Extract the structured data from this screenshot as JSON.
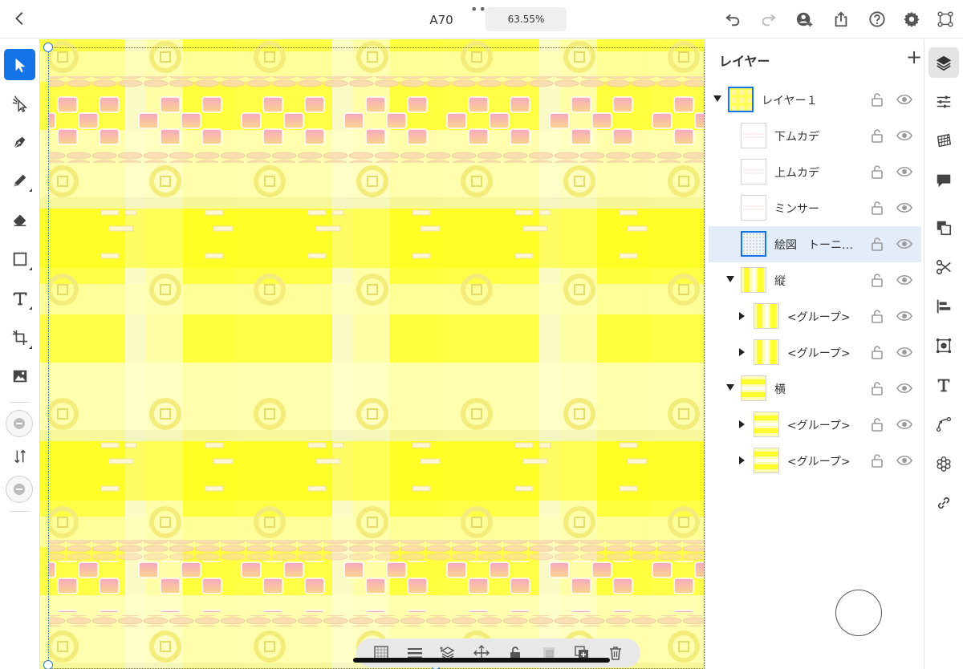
{
  "topbar": {
    "back": "back",
    "title": "A70",
    "more": "•••",
    "zoom": "63.55%"
  },
  "panel": {
    "title": "レイヤー",
    "add": "+",
    "layers": [
      {
        "name": "レイヤー１",
        "depth": 0,
        "expander": "down",
        "thumb": "pattern",
        "selected": false
      },
      {
        "name": "下ムカデ",
        "depth": 1,
        "expander": "none",
        "thumb": "blank",
        "selected": false
      },
      {
        "name": "上ムカデ",
        "depth": 1,
        "expander": "none",
        "thumb": "blank",
        "selected": false
      },
      {
        "name": "ミンサー",
        "depth": 1,
        "expander": "none",
        "thumb": "blank",
        "selected": false
      },
      {
        "name": "絵図　トーニ…",
        "depth": 1,
        "expander": "none",
        "thumb": "dots",
        "selected": true
      },
      {
        "name": "縦",
        "depth": 1,
        "expander": "down",
        "thumb": "vstripes",
        "selected": false
      },
      {
        "name": "<グループ>",
        "depth": 2,
        "expander": "right",
        "thumb": "vstripes",
        "selected": false
      },
      {
        "name": "<グループ>",
        "depth": 2,
        "expander": "right",
        "thumb": "vstripes",
        "selected": false
      },
      {
        "name": "横",
        "depth": 1,
        "expander": "down",
        "thumb": "hstripes",
        "selected": false
      },
      {
        "name": "<グループ>",
        "depth": 2,
        "expander": "right",
        "thumb": "hstripes",
        "selected": false
      },
      {
        "name": "<グループ>",
        "depth": 2,
        "expander": "right",
        "thumb": "hstripes",
        "selected": false
      }
    ]
  },
  "colors": {
    "accent": "#1473e6",
    "canvas_yellow": "#ffff00",
    "canvas_pale": "#ffffb0",
    "tile_pink": "#f7b3b8"
  }
}
